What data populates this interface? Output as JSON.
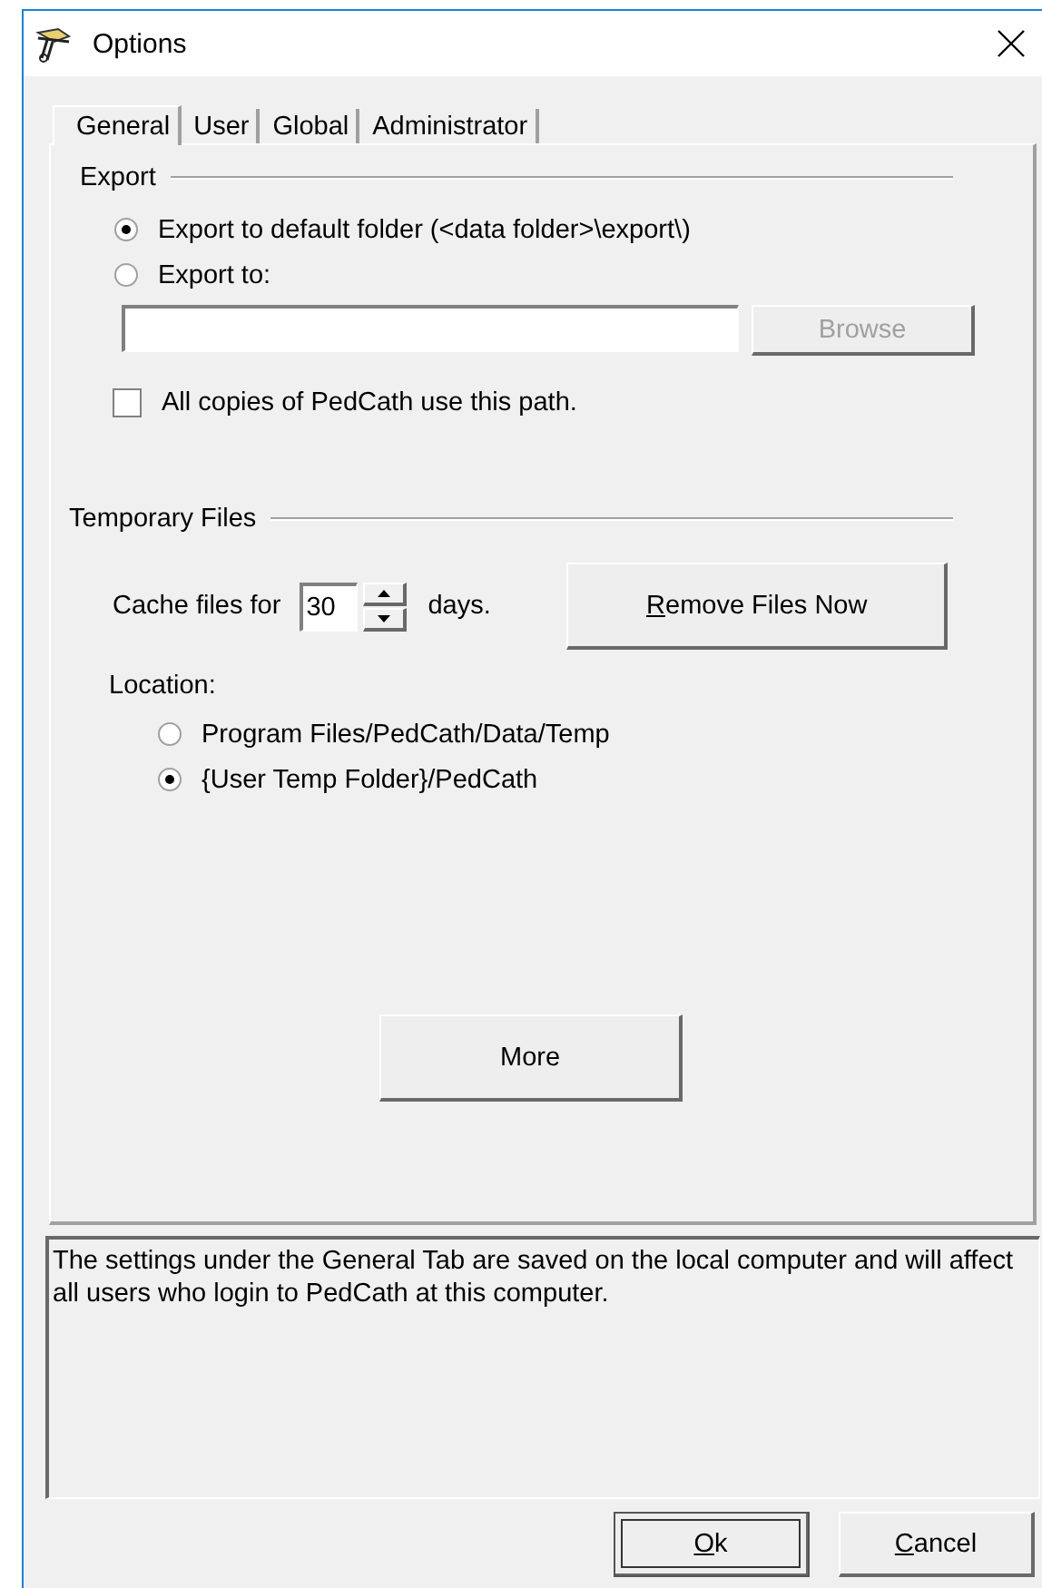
{
  "window": {
    "title": "Options"
  },
  "tabs": [
    {
      "label": "General",
      "selected": true
    },
    {
      "label": "User",
      "selected": false
    },
    {
      "label": "Global",
      "selected": false
    },
    {
      "label": "Administrator",
      "selected": false
    }
  ],
  "export": {
    "title": "Export",
    "options": [
      {
        "label": "Export to default folder (<data folder>\\export\\)",
        "selected": true
      },
      {
        "label": "Export to:",
        "selected": false
      }
    ],
    "browse_button": {
      "label": "Browse",
      "disabled": true
    },
    "shared_path": {
      "label": "All copies of PedCath use this path.",
      "checked": false
    }
  },
  "temporary_files": {
    "title": "Temporary Files",
    "cache_label": "Cache files for",
    "cache_days": "30",
    "days_label": "days.",
    "remove_button": {
      "label": "Remove Files Now",
      "underline_first": true
    },
    "location_label": "Location:",
    "locations": [
      {
        "label": "Program Files/PedCath/Data/Temp",
        "selected": false
      },
      {
        "label": "{User Temp Folder}/PedCath",
        "selected": true
      }
    ]
  },
  "more_button": {
    "label": "More",
    "underline_first": false
  },
  "description": "The settings under the General Tab are saved on the local computer and will affect all users who login to PedCath at this computer.",
  "buttons": [
    {
      "label": "Ok",
      "underline_first": true,
      "default": true
    },
    {
      "label": "Cancel",
      "underline_first": true,
      "default": false
    }
  ]
}
